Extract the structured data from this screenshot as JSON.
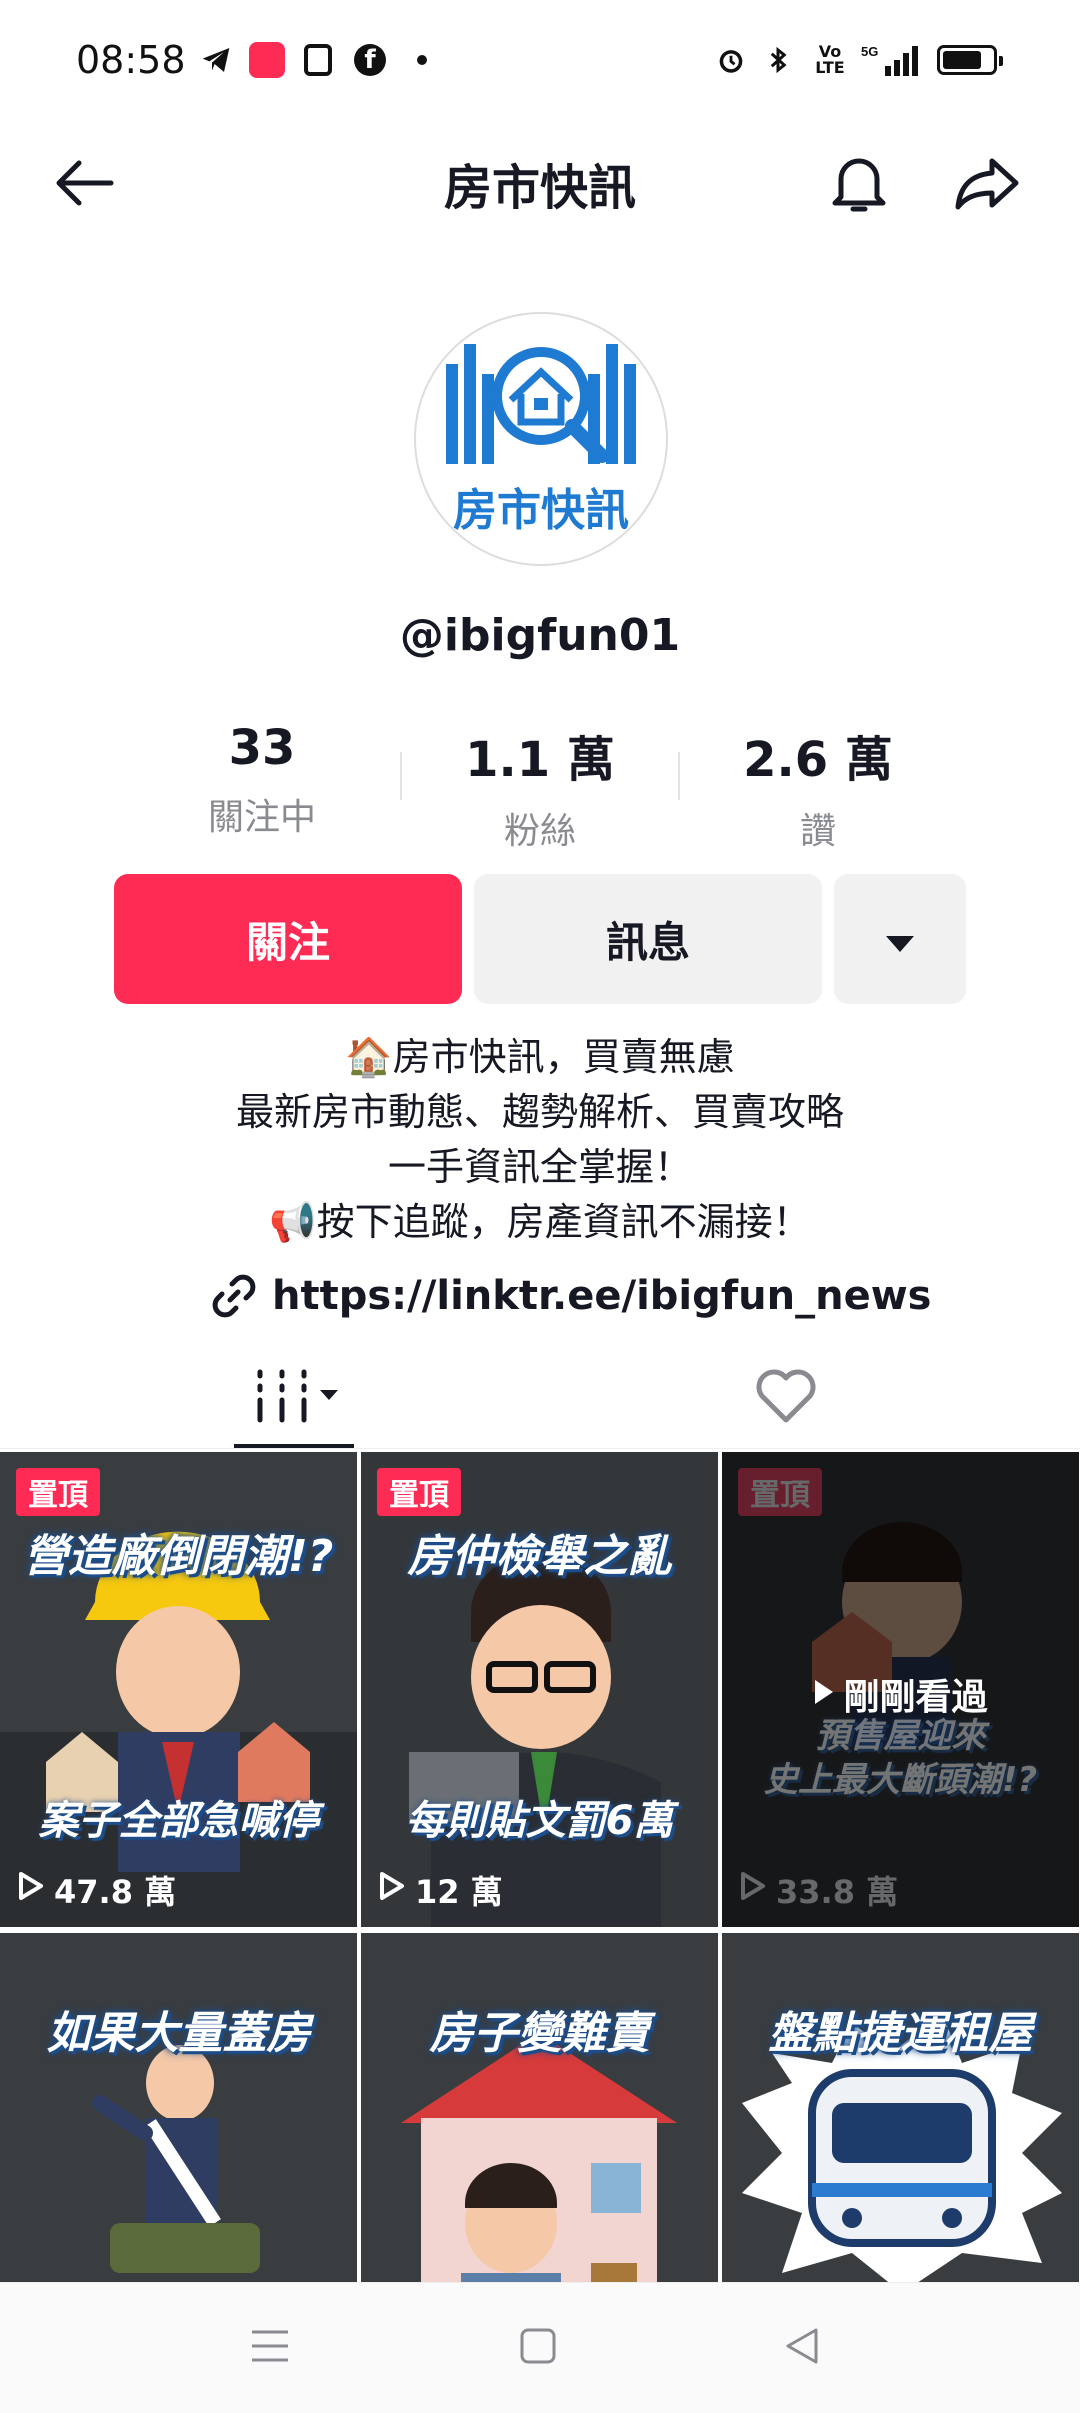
{
  "status_bar": {
    "time": "08:58",
    "icons": [
      "telegram-icon",
      "xiaohongshu-icon",
      "notes-icon",
      "facebook-icon",
      "dot-icon",
      "alarm-icon",
      "bluetooth-icon",
      "volte-icon",
      "signal-5g-icon",
      "battery-icon"
    ]
  },
  "header": {
    "title": "房市快訊",
    "icons": [
      "back-arrow-icon",
      "bell-icon",
      "share-icon"
    ]
  },
  "profile": {
    "avatar_text": "房市快訊",
    "username": "@ibigfun01",
    "stats": [
      {
        "value": "33",
        "label": "關注中"
      },
      {
        "value": "1.1 萬",
        "label": "粉絲"
      },
      {
        "value": "2.6 萬",
        "label": "讚"
      }
    ],
    "follow_label": "關注",
    "message_label": "訊息",
    "bio_lines": [
      "🏠房市快訊，買賣無慮",
      "最新房市動態、趨勢解析、買賣攻略",
      "一手資訊全掌握！",
      "📢按下追蹤，房產資訊不漏接！"
    ],
    "link": "https://linktr.ee/ibigfun_news"
  },
  "colors": {
    "accent": "#fe2c55",
    "button_gray": "#f1f1f2",
    "text_muted": "#8a8b91"
  },
  "videos": [
    {
      "pinned": "置頂",
      "title": "營造廠倒閉潮!?",
      "subtitle": "案子全部急喊停",
      "views": "47.8 萬"
    },
    {
      "pinned": "置頂",
      "title": "房仲檢舉之亂",
      "subtitle": "每則貼文罰6萬",
      "views": "12 萬"
    },
    {
      "pinned": "置頂",
      "overlay": "剛剛看過",
      "subtitle": "預售屋迎來\n史上最大斷頭潮!?",
      "views": "33.8 萬"
    },
    {
      "title": "如果大量蓋房"
    },
    {
      "title": "房子變難賣"
    },
    {
      "title": "盤點捷運租屋"
    }
  ]
}
